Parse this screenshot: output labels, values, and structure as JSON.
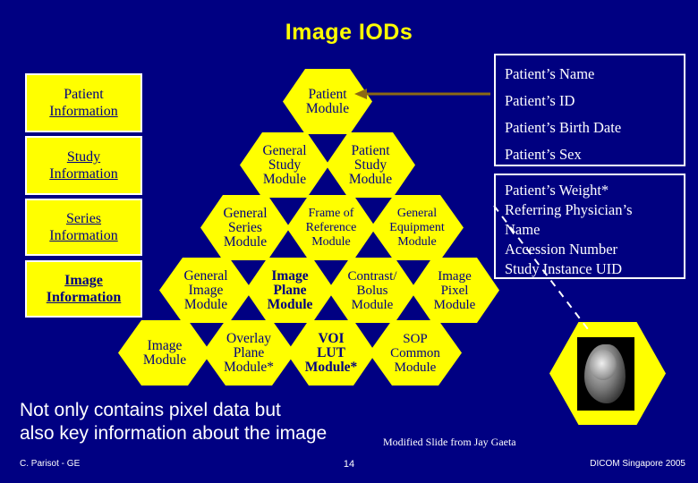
{
  "slide": {
    "title": "Image IODs",
    "bottom_text_line1": "Not only contains pixel data but",
    "bottom_text_line2": "also key information about the image",
    "credit": "Modified Slide from Jay Gaeta",
    "footer_left": "C. Parisot - GE",
    "footer_center": "14",
    "footer_right": "DICOM Singapore 2005"
  },
  "left_labels": [
    {
      "line1": "Patient",
      "line2": "Information"
    },
    {
      "line1": "Study",
      "line2": "Information"
    },
    {
      "line1": "Series",
      "line2": "Information"
    },
    {
      "line1": "Image",
      "line2": "Information"
    }
  ],
  "hexes": {
    "row1": [
      {
        "lines": [
          "Patient",
          "Module"
        ]
      }
    ],
    "row2": [
      {
        "lines": [
          "General",
          "Study",
          "Module"
        ]
      },
      {
        "lines": [
          "Patient",
          "Study",
          "Module"
        ]
      }
    ],
    "row3": [
      {
        "lines": [
          "General",
          "Series",
          "Module"
        ]
      },
      {
        "lines": [
          "Frame of",
          "Reference",
          "Module"
        ]
      },
      {
        "lines": [
          "General",
          "Equipment",
          "Module"
        ]
      }
    ],
    "row4": [
      {
        "lines": [
          "General",
          "Image",
          "Module"
        ]
      },
      {
        "lines": [
          "Image",
          "Plane",
          "Module"
        ]
      },
      {
        "lines": [
          "Contrast/",
          "Bolus",
          "Module"
        ]
      },
      {
        "lines": [
          "Image",
          "Pixel",
          "Module"
        ]
      }
    ],
    "row5": [
      {
        "lines": [
          "Image",
          "Module"
        ]
      },
      {
        "lines": [
          "Overlay",
          "Plane",
          "Module*"
        ]
      },
      {
        "lines": [
          "VOI",
          "LUT",
          "Module*"
        ]
      },
      {
        "lines": [
          "SOP",
          "Common",
          "Module"
        ]
      }
    ]
  },
  "right_panels": {
    "patient_attributes": [
      "Patient’s Name",
      "Patient’s ID",
      "Patient’s Birth Date",
      "Patient’s Sex"
    ],
    "study_attributes": [
      "Patient’s Weight*",
      "Referring Physician’s",
      "Name",
      "Accession Number",
      "Study Instance UID"
    ]
  },
  "colors": {
    "background": "#000082",
    "hex_fill": "#FFFF00",
    "hex_text": "#000080",
    "title": "#FFFF00",
    "panel_border": "#FFFFFF",
    "arrow": "#8B6914"
  }
}
